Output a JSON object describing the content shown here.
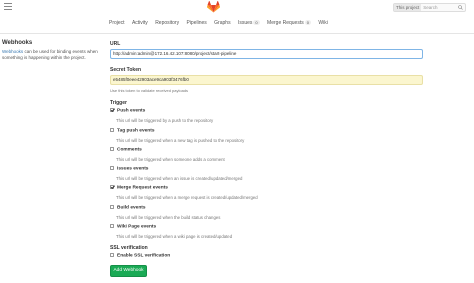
{
  "header": {
    "search_scope": "This project",
    "search_placeholder": "Search"
  },
  "nav": {
    "items": [
      "Project",
      "Activity",
      "Repository",
      "Pipelines",
      "Graphs",
      "Issues",
      "Merge Requests",
      "Wiki"
    ],
    "issues_count": "0",
    "merge_requests_count": "0"
  },
  "sidebar": {
    "title": "Webhooks",
    "desc_link": "Webhooks",
    "desc_rest": " can be used for binding events when something is happening within the project."
  },
  "form": {
    "url_label": "URL",
    "url_value": "http://admin:admin@172.16.42.107:8080/project/start-pipeline",
    "token_label": "Secret Token",
    "token_value": "e5485f0eee42903ace9ca903f3476fb0",
    "token_help": "Use this token to validate received payloads",
    "trigger_label": "Trigger",
    "triggers": [
      {
        "label": "Push events",
        "desc": "This url will be triggered by a push to the repository",
        "checked": true
      },
      {
        "label": "Tag push events",
        "desc": "This url will be triggered when a new tag is pushed to the repository",
        "checked": false
      },
      {
        "label": "Comments",
        "desc": "This url will be triggered when someone adds a comment",
        "checked": false
      },
      {
        "label": "Issues events",
        "desc": "This url will be triggered when an issue is created/updated/merged",
        "checked": false
      },
      {
        "label": "Merge Request events",
        "desc": "This url will be triggered when a merge request is created/updated/merged",
        "checked": true
      },
      {
        "label": "Build events",
        "desc": "This url will be triggered when the build status changes",
        "checked": false
      },
      {
        "label": "Wiki Page events",
        "desc": "This url will be triggered when a wiki page is created/updated",
        "checked": false
      }
    ],
    "ssl_label": "SSL verification",
    "ssl_option": "Enable SSL verification",
    "ssl_checked": false,
    "submit_label": "Add Webhook"
  },
  "colors": {
    "accent": "#1aaa55",
    "link": "#3777b0",
    "token_bg": "#fbf6cf",
    "logo": "#e24329"
  }
}
